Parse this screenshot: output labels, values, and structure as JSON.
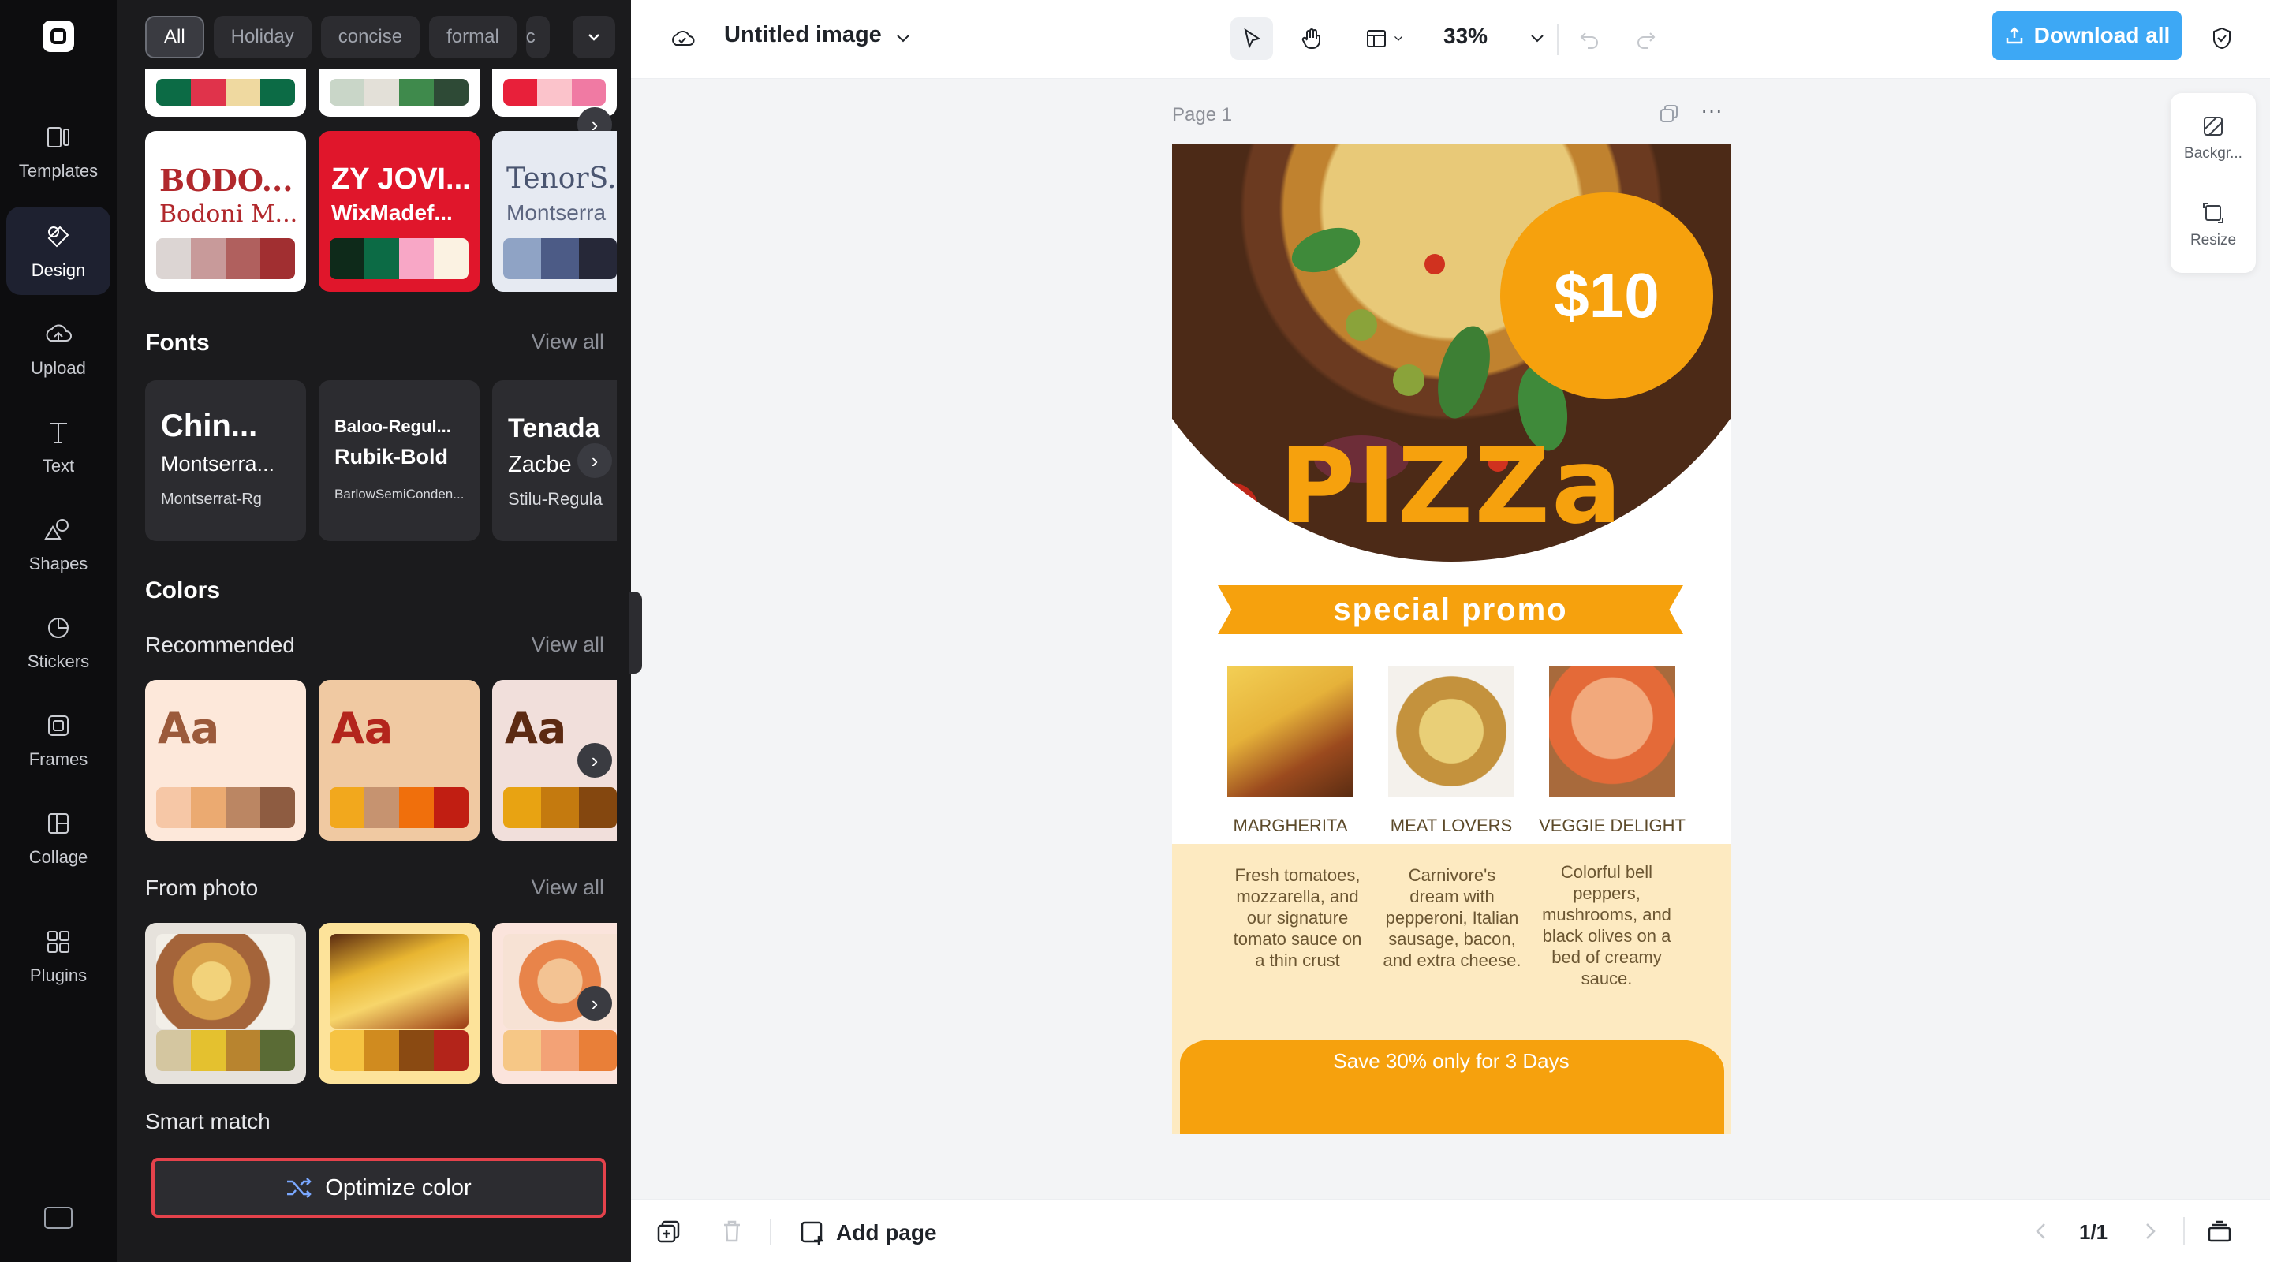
{
  "rail": {
    "items": [
      {
        "label": "Templates",
        "icon": "templates-icon"
      },
      {
        "label": "Design",
        "icon": "design-icon"
      },
      {
        "label": "Upload",
        "icon": "upload-icon"
      },
      {
        "label": "Text",
        "icon": "text-icon"
      },
      {
        "label": "Shapes",
        "icon": "shapes-icon"
      },
      {
        "label": "Stickers",
        "icon": "stickers-icon"
      },
      {
        "label": "Frames",
        "icon": "frames-icon"
      },
      {
        "label": "Collage",
        "icon": "collage-icon"
      },
      {
        "label": "Plugins",
        "icon": "plugins-icon"
      }
    ],
    "active": "Design"
  },
  "panel": {
    "chips": [
      "All",
      "Holiday",
      "concise",
      "formal",
      "c"
    ],
    "style_cards": [
      {
        "title": "BODO...",
        "subtitle": "Bodoni M...",
        "bg": "#ffffff",
        "title_color": "#b1282c",
        "colors": [
          "#dcd5d3",
          "#c89a9a",
          "#b0605e",
          "#a12f31"
        ]
      },
      {
        "title": "ZY JOVI...",
        "subtitle": "WixMadef...",
        "bg": "#e0162b",
        "title_color": "#ffffff",
        "colors": [
          "#0e2a1a",
          "#0c6b45",
          "#f8a7c6",
          "#fbf2e2"
        ]
      },
      {
        "title": "TenorS...",
        "subtitle": "Montserra",
        "bg": "#e6eaf2",
        "title_color": "#4a5570",
        "colors": [
          "#8fa3c5",
          "#4c5b86",
          "#262838"
        ]
      }
    ],
    "fonts": {
      "title": "Fonts",
      "view_all": "View all",
      "cards": [
        {
          "a": "Chin...",
          "b": "Montserra...",
          "c": "Montserrat-Rg"
        },
        {
          "a": "Baloo-Regul...",
          "b": "Rubik-Bold",
          "c": "BarlowSemiConden..."
        },
        {
          "a": "Tenada",
          "b": "Zacbe",
          "c": "Stilu-Regula"
        }
      ]
    },
    "colors": {
      "title": "Colors",
      "recommended_title": "Recommended",
      "view_all": "View all",
      "recommended": [
        {
          "aa": "Aa",
          "bg": "#fde8da",
          "text": "#9b5a3b",
          "colors": [
            "#f6c7a6",
            "#ebaa71",
            "#bb8663",
            "#8e5c41"
          ]
        },
        {
          "aa": "Aa",
          "bg": "#f0c9a2",
          "text": "#b3251c",
          "colors": [
            "#f2a81d",
            "#c69370",
            "#f06f0c",
            "#c11e12"
          ]
        },
        {
          "aa": "Aa",
          "bg": "#f1dfdb",
          "text": "#5c2a12",
          "colors": [
            "#e8a312",
            "#c47a0f",
            "#84470f"
          ]
        }
      ],
      "from_photo_title": "From photo",
      "from_photo_view_all": "View all",
      "from_photo": [
        {
          "bg": "#e6e2dc",
          "colors": [
            "#d4c6a0",
            "#e4c12f",
            "#b8842f",
            "#5a6b35"
          ]
        },
        {
          "bg": "#fde39a",
          "colors": [
            "#f6c342",
            "#d08b1f",
            "#8a4a12",
            "#b3241a"
          ]
        },
        {
          "bg": "#fbe4dc",
          "colors": [
            "#f6c786",
            "#f3a276",
            "#e97f38"
          ]
        }
      ],
      "smart_match_title": "Smart match",
      "optimize_label": "Optimize color"
    }
  },
  "topbar": {
    "doc_title": "Untitled image",
    "zoom": "33%",
    "download_label": "Download all"
  },
  "canvas": {
    "page_label": "Page 1",
    "poster": {
      "price": "$10",
      "headline": "PIZZa",
      "banner": "special promo",
      "items": [
        {
          "name": "MARGHERITA",
          "desc": "Fresh tomatoes, mozzarella, and our signature tomato sauce on a thin crust"
        },
        {
          "name": "MEAT LOVERS",
          "desc": "Carnivore's dream with pepperoni, Italian sausage, bacon, and extra cheese."
        },
        {
          "name": "VEGGIE DELIGHT",
          "desc": "Colorful bell peppers, mushrooms, and black olives on a bed of creamy sauce."
        }
      ],
      "footer": "Save 30% only for 3 Days"
    }
  },
  "right_panel": {
    "background_label": "Backgr...",
    "resize_label": "Resize"
  },
  "bottombar": {
    "add_page_label": "Add page",
    "page_indicator": "1/1"
  }
}
